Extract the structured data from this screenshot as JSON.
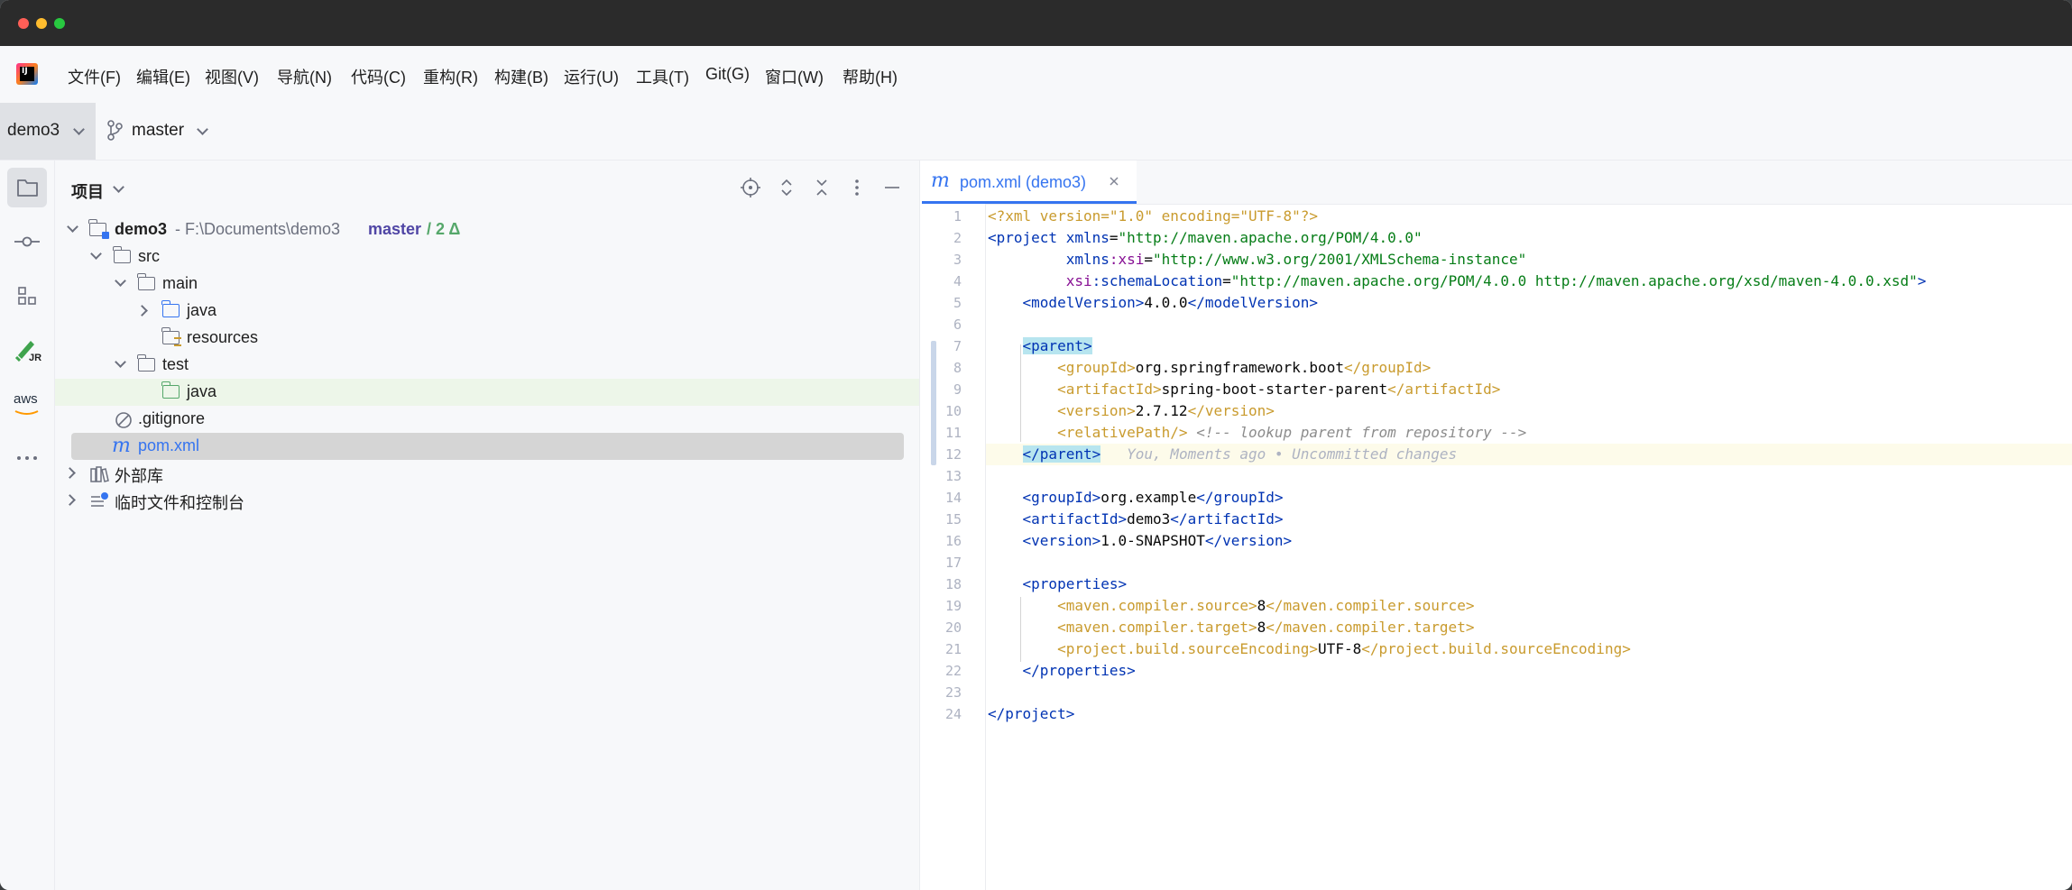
{
  "menubar": {
    "items": [
      "文件(F)",
      "编辑(E)",
      "视图(V)",
      "导航(N)",
      "代码(C)",
      "重构(R)",
      "构建(B)",
      "运行(U)",
      "工具(T)",
      "Git(G)",
      "窗口(W)",
      "帮助(H)"
    ]
  },
  "toolbar": {
    "project": "demo3",
    "branch": "master"
  },
  "stripe": {
    "aws_label": "aws",
    "jr_label": "JR"
  },
  "project_panel": {
    "title": "项目",
    "tree": {
      "root_name": "demo3",
      "root_path": " - F:\\Documents\\demo3",
      "root_branch": "master",
      "root_changes": "/ 2 Δ",
      "src": "src",
      "main": "main",
      "main_java": "java",
      "resources": "resources",
      "test": "test",
      "test_java": "java",
      "gitignore": ".gitignore",
      "pom": "pom.xml",
      "external_libs": "外部库",
      "scratches": "临时文件和控制台"
    }
  },
  "editor": {
    "tab_label": "pom.xml (demo3)",
    "tab_icon_glyph": "m",
    "line_numbers": [
      "1",
      "2",
      "3",
      "4",
      "5",
      "6",
      "7",
      "8",
      "9",
      "10",
      "11",
      "12",
      "13",
      "14",
      "15",
      "16",
      "17",
      "18",
      "19",
      "20",
      "21",
      "22",
      "23",
      "24"
    ],
    "inlay_hint": "You, Moments ago • Uncommitted changes",
    "code": {
      "l1_decl": "<?xml version=\"1.0\" encoding=\"UTF-8\"?>",
      "l2_open": "<project ",
      "l2_attr": "xmlns",
      "l2_val": "\"http://maven.apache.org/POM/4.0.0\"",
      "l3_attr_ns": "xmlns",
      "l3_attr_name": ":xsi",
      "l3_val": "\"http://www.w3.org/2001/XMLSchema-instance\"",
      "l4_attr_ns": "xsi",
      "l4_attr_name": ":schemaLocation",
      "l4_val": "\"http://maven.apache.org/POM/4.0.0 http://maven.apache.org/xsd/maven-4.0.0.xsd\"",
      "l4_close": ">",
      "l5_open": "<modelVersion>",
      "l5_text": "4.0.0",
      "l5_close": "</modelVersion>",
      "l7_open": "<parent>",
      "l8_open": "<groupId>",
      "l8_text": "org.springframework.boot",
      "l8_close": "</groupId>",
      "l9_open": "<artifactId>",
      "l9_text": "spring-boot-starter-parent",
      "l9_close": "</artifactId>",
      "l10_open": "<version>",
      "l10_text": "2.7.12",
      "l10_close": "</version>",
      "l11_tag": "<relativePath/>",
      "l11_comment": " <!-- lookup parent from repository -->",
      "l12_close": "</parent>",
      "l14_open": "<groupId>",
      "l14_text": "org.example",
      "l14_close": "</groupId>",
      "l15_open": "<artifactId>",
      "l15_text": "demo3",
      "l15_close": "</artifactId>",
      "l16_open": "<version>",
      "l16_text": "1.0-SNAPSHOT",
      "l16_close": "</version>",
      "l18_open": "<properties>",
      "l19_open": "<maven.compiler.source>",
      "l19_text": "8",
      "l19_close": "</maven.compiler.source>",
      "l20_open": "<maven.compiler.target>",
      "l20_text": "8",
      "l20_close": "</maven.compiler.target>",
      "l21_open": "<project.build.sourceEncoding>",
      "l21_text": "UTF-8",
      "l21_close": "</project.build.sourceEncoding>",
      "l22_close": "</properties>",
      "l24_close": "</project>"
    }
  },
  "colors": {
    "accent": "#3574f0",
    "tag": "#0033b3",
    "string": "#067d17",
    "highlight": "#b7e5ef"
  }
}
